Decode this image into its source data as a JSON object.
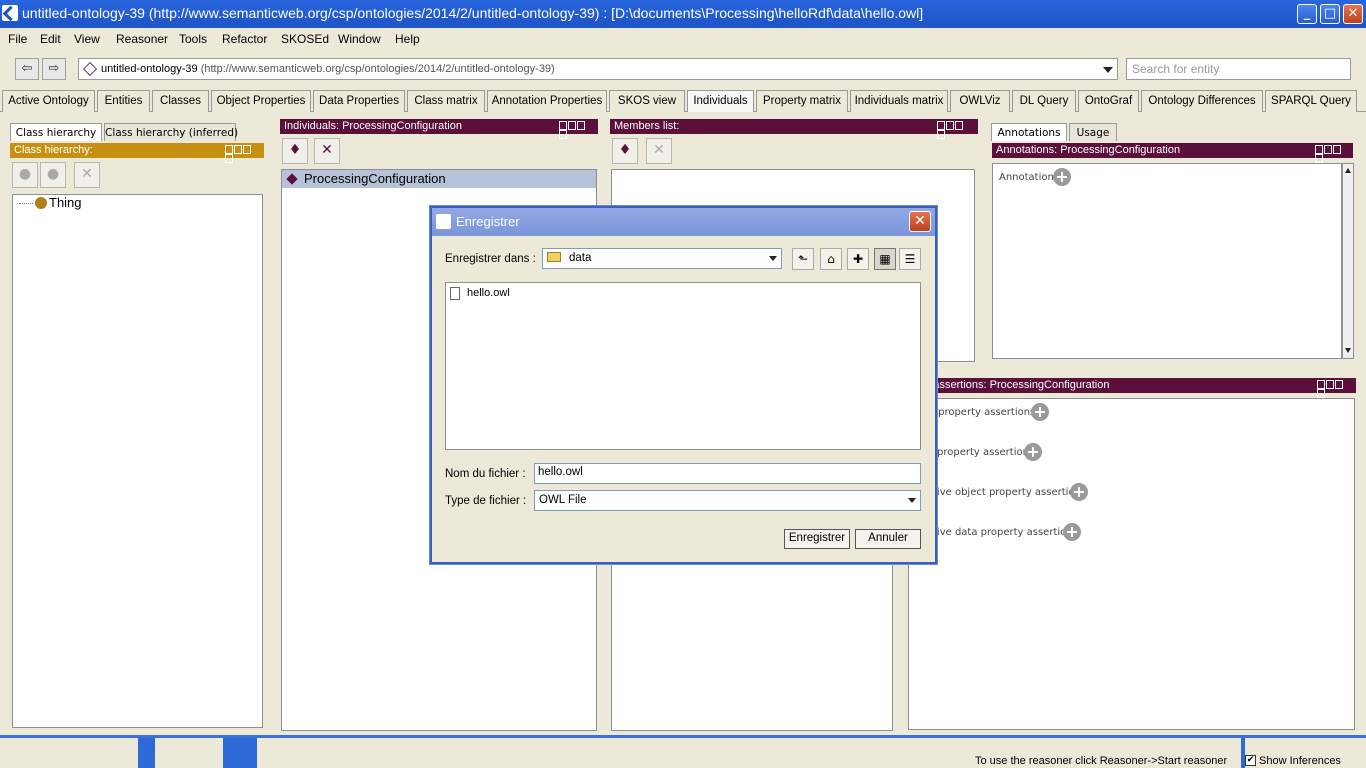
{
  "window": {
    "title": "untitled-ontology-39 (http://www.semanticweb.org/csp/ontologies/2014/2/untitled-ontology-39)  : [D:\\documents\\Processing\\helloRdf\\data\\hello.owl]",
    "minimize_glyph": "_",
    "maximize_glyph": "□",
    "close_glyph": "✕"
  },
  "menu": [
    "File",
    "Edit",
    "View",
    "Reasoner",
    "Tools",
    "Refactor",
    "SKOSEd",
    "Window",
    "Help"
  ],
  "nav": {
    "back_glyph": "⇦",
    "forward_glyph": "⇨",
    "ontology_name": "untitled-ontology-39",
    "ontology_iri": "(http://www.semanticweb.org/csp/ontologies/2014/2/untitled-ontology-39)",
    "search_placeholder": "Search for entity"
  },
  "tabs": [
    "Active Ontology",
    "Entities",
    "Classes",
    "Object Properties",
    "Data Properties",
    "Class matrix",
    "Annotation Properties",
    "SKOS view",
    "Individuals",
    "Property matrix",
    "Individuals matrix",
    "OWLViz",
    "DL Query",
    "OntoGraf",
    "Ontology Differences",
    "SPARQL Query"
  ],
  "active_tab": "Individuals",
  "class_panel": {
    "tab_hierarchy": "Class hierarchy",
    "tab_inferred": "Class hierarchy (inferred)",
    "header": "Class hierarchy:",
    "root": "Thing"
  },
  "individuals_panel": {
    "header": "Individuals: ProcessingConfiguration",
    "add_glyph": "♦",
    "delete_glyph": "✕",
    "items": [
      "ProcessingConfiguration"
    ]
  },
  "members_panel": {
    "header": "Members list:",
    "add_glyph": "♦",
    "delete_glyph": "✕"
  },
  "annotations_panel": {
    "tab_annotations": "Annotations",
    "tab_usage": "Usage",
    "header": "Annotations: ProcessingConfiguration",
    "label": "Annotations",
    "plus_glyph": "+"
  },
  "property_panel": {
    "header": "erty assertions: ProcessingConfiguration",
    "rows": [
      "t property assertions",
      "property assertions",
      "tive object property assertions",
      "tive data property assertions"
    ],
    "plus_glyph": "+"
  },
  "dialog": {
    "title": "Enregistrer",
    "close_glyph": "✕",
    "save_in_label": "Enregistrer dans :",
    "save_in_value": "data",
    "up_glyph": "⬑",
    "home_glyph": "⌂",
    "newfolder_glyph": "✚",
    "list_glyph": "▦",
    "details_glyph": "☰",
    "files": [
      "hello.owl"
    ],
    "filename_label": "Nom du fichier :",
    "filename_value": "hello.owl",
    "filetype_label": "Type de fichier :",
    "filetype_value": "OWL File",
    "save_button": "Enregistrer",
    "cancel_button": "Annuler"
  },
  "status": {
    "message": "To use the reasoner click Reasoner->Start reasoner",
    "show_inferences": "Show Inferences",
    "check_glyph": "✔"
  },
  "colors": {
    "title_blue": "#1d53c4",
    "panel_header": "#5b0f3b",
    "class_header": "#c69112"
  }
}
